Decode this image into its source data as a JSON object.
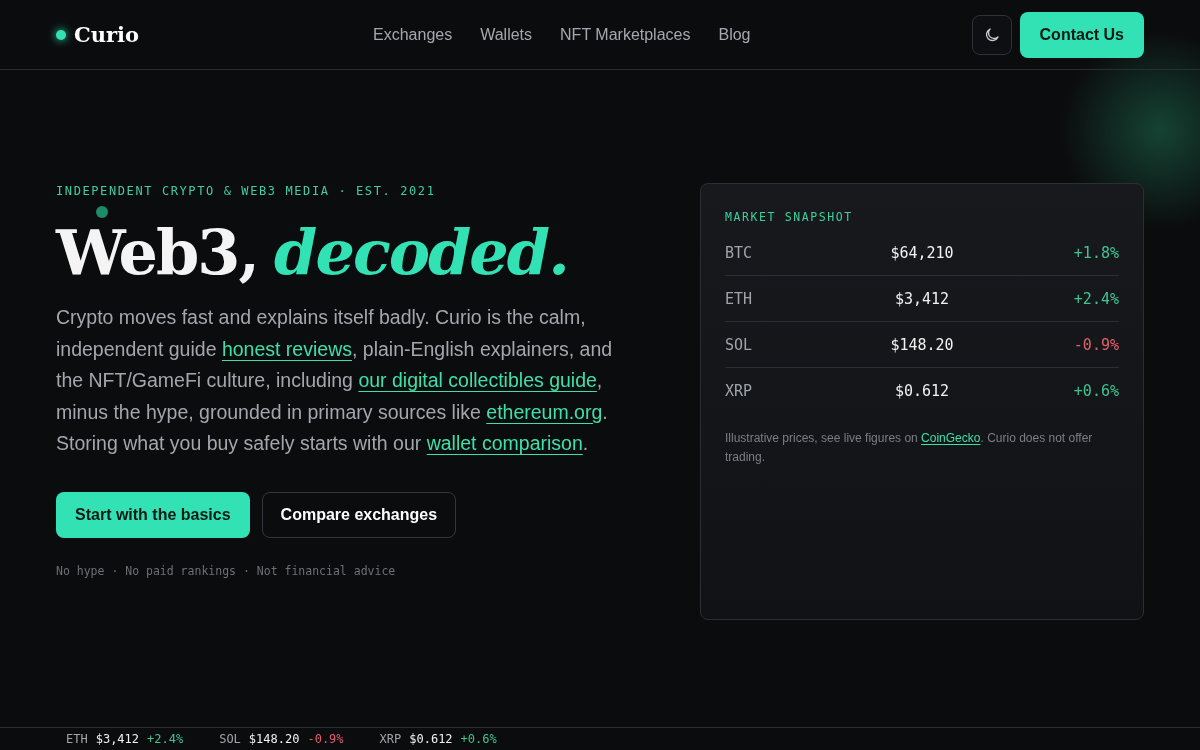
{
  "header": {
    "logo": "Curio",
    "nav": [
      "Exchanges",
      "Wallets",
      "NFT Marketplaces",
      "Blog"
    ],
    "contact_button": "Contact Us"
  },
  "hero": {
    "eyebrow": "INDEPENDENT CRYPTO & WEB3 MEDIA · EST. 2021",
    "title": "Web3,",
    "title_accent": "decoded.",
    "paragraph": [
      {
        "kind": "text",
        "text": "Crypto moves fast and explains itself badly. Curio is the calm, independent guide "
      },
      {
        "kind": "link",
        "text": "honest reviews"
      },
      {
        "kind": "text",
        "text": ", plain-English explainers, and the NFT/GameFi culture, including "
      },
      {
        "kind": "link",
        "text": "our digital collectibles guide"
      },
      {
        "kind": "text",
        "text": ", minus the hype, grounded in primary sources like "
      },
      {
        "kind": "link",
        "text": "ethereum.org"
      },
      {
        "kind": "text",
        "text": ". Storing what you buy safely starts with our "
      },
      {
        "kind": "link",
        "text": "wallet comparison"
      },
      {
        "kind": "text",
        "text": "."
      }
    ],
    "primary_button": "Start with the basics",
    "secondary_button": "Compare exchanges",
    "footnote": "No hype · No paid rankings · Not financial advice"
  },
  "market": {
    "title": "MARKET SNAPSHOT",
    "rows": [
      {
        "symbol": "BTC",
        "price": "$64,210",
        "change": "+1.8%",
        "color": "#3fc48f"
      },
      {
        "symbol": "ETH",
        "price": "$3,412",
        "change": "+2.4%",
        "color": "#3fc48f"
      },
      {
        "symbol": "SOL",
        "price": "$148.20",
        "change": "-0.9%",
        "color": "#e0606a"
      },
      {
        "symbol": "XRP",
        "price": "$0.612",
        "change": "+0.6%",
        "color": "#3fc48f"
      }
    ],
    "note": [
      {
        "kind": "text",
        "text": "Illustrative prices, see live figures on "
      },
      {
        "kind": "link",
        "text": "CoinGecko"
      },
      {
        "kind": "text",
        "text": ". Curio does not offer trading."
      }
    ]
  },
  "ticker": [
    {
      "symbol": "ETH",
      "price": "$3,412",
      "change": "+2.4%",
      "color": "#3fc48f"
    },
    {
      "symbol": "SOL",
      "price": "$148.20",
      "change": "-0.9%",
      "color": "#e0606a"
    },
    {
      "symbol": "XRP",
      "price": "$0.612",
      "change": "+0.6%",
      "color": "#3fc48f"
    }
  ]
}
